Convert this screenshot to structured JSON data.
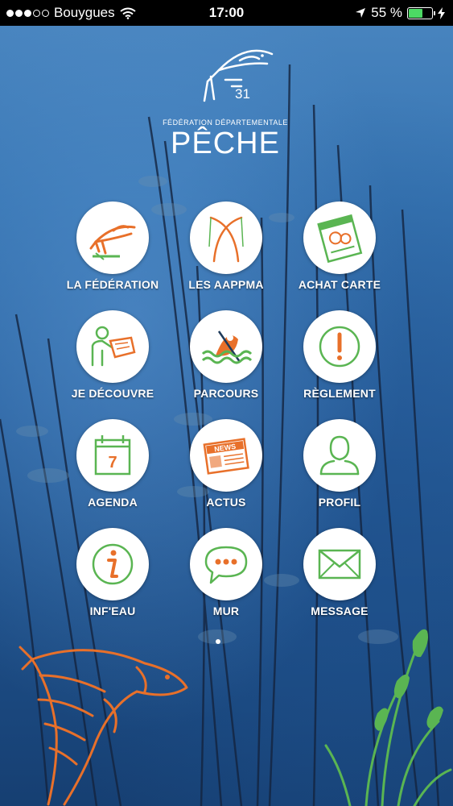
{
  "status_bar": {
    "carrier": "Bouygues",
    "time": "17:00",
    "battery": "55 %",
    "battery_level_percent": 55
  },
  "logo": {
    "number": "31",
    "subtitle": "FÉDÉRATION DÉPARTEMENTALE",
    "title": "PÊCHE"
  },
  "menu": {
    "items": [
      {
        "label": "LA FÉDÉRATION",
        "icon": "fish-icon"
      },
      {
        "label": "LES AAPPMA",
        "icon": "fishing-rods-icon"
      },
      {
        "label": "ACHAT CARTE",
        "icon": "fishing-card-icon"
      },
      {
        "label": "JE DÉCOUVRE",
        "icon": "person-reading-icon"
      },
      {
        "label": "PARCOURS",
        "icon": "kayak-icon"
      },
      {
        "label": "RÈGLEMENT",
        "icon": "exclamation-icon"
      },
      {
        "label": "AGENDA",
        "icon": "calendar-icon"
      },
      {
        "label": "ACTUS",
        "icon": "newspaper-icon"
      },
      {
        "label": "PROFIL",
        "icon": "profile-icon"
      },
      {
        "label": "INF'EAU",
        "icon": "info-icon"
      },
      {
        "label": "MUR",
        "icon": "chat-bubble-icon"
      },
      {
        "label": "MESSAGE",
        "icon": "envelope-icon"
      }
    ],
    "calendar_day": "7",
    "news_text": "NEWS"
  },
  "colors": {
    "orange": "#e8702a",
    "green": "#5ab552",
    "background_blue": "#2a62a0"
  },
  "pager": {
    "current_page": 1
  }
}
